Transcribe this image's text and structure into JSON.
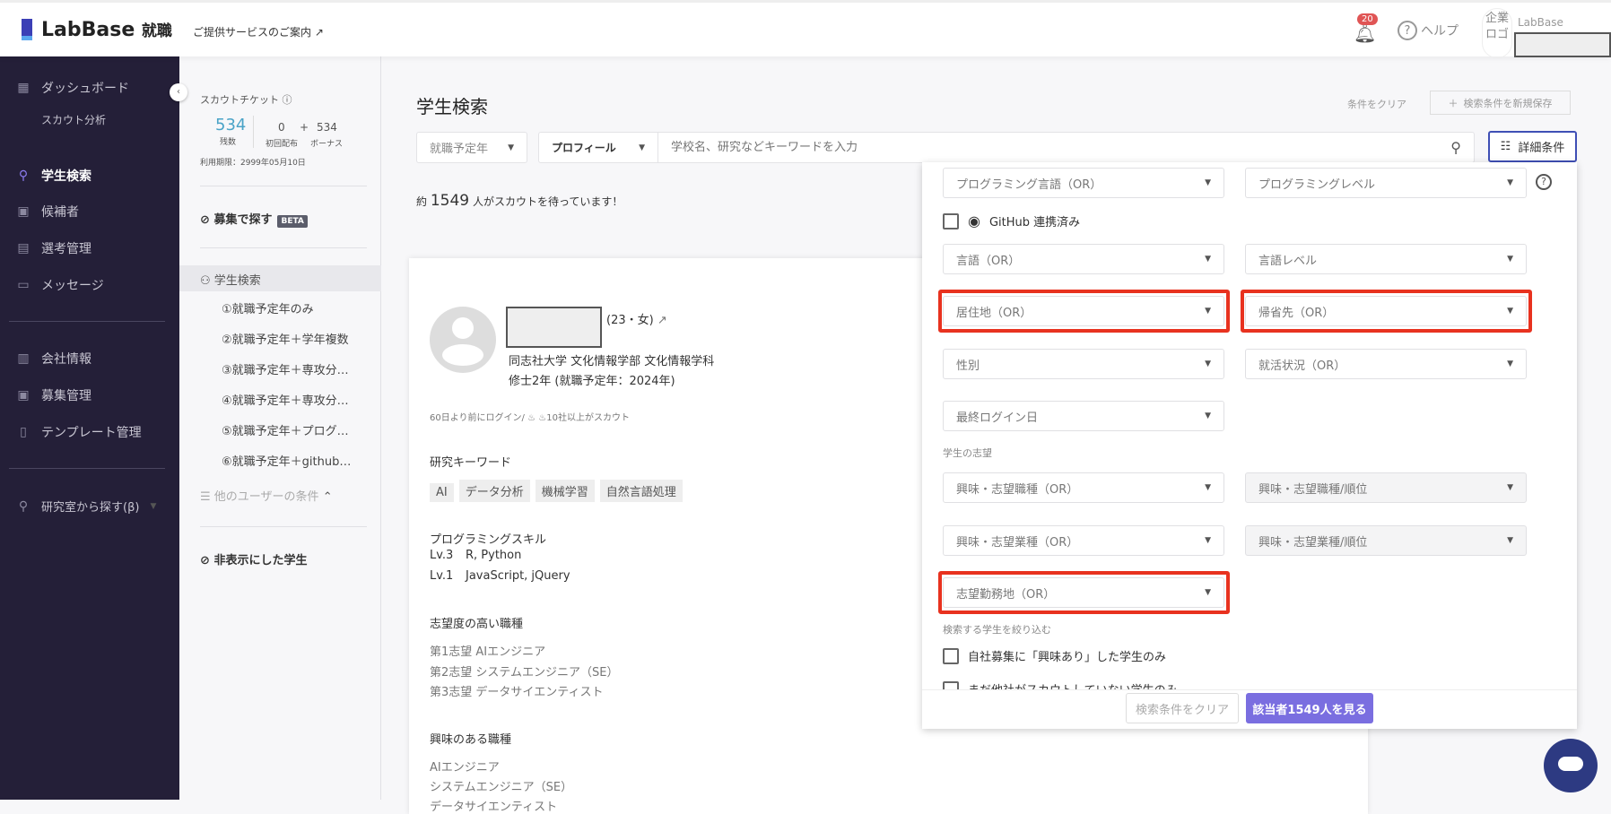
{
  "header": {
    "brand": "LabBase",
    "brand_suffix": "就職",
    "services_link": "ご提供サービスのご案内",
    "notification_count": "20",
    "help": "ヘルプ",
    "company_logo_alt": "企業ロゴ",
    "account_label": "LabBase"
  },
  "nav": {
    "items": [
      {
        "label": "ダッシュボード",
        "icon": "dashboard-icon"
      },
      {
        "label": "スカウト分析"
      },
      {
        "label": "学生検索",
        "icon": "search-icon",
        "active": true
      },
      {
        "label": "候補者",
        "icon": "candidate-icon"
      },
      {
        "label": "選考管理",
        "icon": "selection-icon"
      },
      {
        "label": "メッセージ",
        "icon": "message-icon"
      },
      {
        "label": "会社情報",
        "icon": "building-icon"
      },
      {
        "label": "募集管理",
        "icon": "recruit-icon"
      },
      {
        "label": "テンプレート管理",
        "icon": "document-icon"
      },
      {
        "label": "研究室から探す(β)",
        "icon": "search-icon"
      }
    ]
  },
  "sub": {
    "ticket_title": "スカウトチケット",
    "remaining": "534",
    "remaining_label": "残数",
    "initial": "0",
    "plus": "+",
    "bonus": "534",
    "initial_label": "初回配布",
    "bonus_label": "ボーナス",
    "expiry": "利用期限：2999年05月10日",
    "recruit_search": "募集で探す",
    "beta": "BETA",
    "student_search": "学生検索",
    "saved": [
      "①就職予定年のみ",
      "②就職予定年＋学年複数",
      "③就職予定年＋専攻分…",
      "④就職予定年＋専攻分…",
      "⑤就職予定年＋プログ…",
      "⑥就職予定年＋github…"
    ],
    "other_users": "他のユーザーの条件",
    "hidden": "非表示にした学生"
  },
  "main": {
    "title": "学生検索",
    "clear": "条件をクリア",
    "save": "検索条件を新規保存",
    "year_select": "就職予定年",
    "profile_select": "プロフィール",
    "search_placeholder": "学校名、研究などキーワードを入力",
    "detail": "詳細条件",
    "count_prefix": "約",
    "count": "1549",
    "count_suffix": "人がスカウトを待っています！"
  },
  "card": {
    "age_gender": "(23・女)",
    "school": "同志社大学 文化情報学部 文化情報学科",
    "grade": "修士2年 (就職予定年：2024年)",
    "login": "60日より前にログイン/",
    "scouted": "10社以上がスカウト",
    "kw_title": "研究キーワード",
    "keywords": [
      "AI",
      "データ分析",
      "機械学習",
      "自然言語処理"
    ],
    "skill_title": "プログラミングスキル",
    "skills": [
      {
        "level": "Lv.3",
        "langs": "R, Python"
      },
      {
        "level": "Lv.1",
        "langs": "JavaScript, jQuery"
      }
    ],
    "wish_title": "志望度の高い職種",
    "wishes": [
      "第1志望 AIエンジニア",
      "第2志望 システムエンジニア（SE）",
      "第3志望 データサイエンティスト"
    ],
    "interest_title": "興味のある職種",
    "interests": [
      "AIエンジニア",
      "システムエンジニア（SE）",
      "データサイエンティスト"
    ]
  },
  "panel": {
    "prog_lang": "プログラミング言語（OR）",
    "prog_level": "プログラミングレベル",
    "github": "GitHub 連携済み",
    "lang": "言語（OR）",
    "lang_level": "言語レベル",
    "residence": "居住地（OR）",
    "hometown": "帰省先（OR）",
    "gender": "性別",
    "job_status": "就活状況（OR）",
    "last_login": "最終ログイン日",
    "wish_section": "学生の志望",
    "job_type": "興味・志望職種（OR）",
    "job_type_rank": "興味・志望職種/順位",
    "industry": "興味・志望業種（OR）",
    "industry_rank": "興味・志望業種/順位",
    "work_location": "志望勤務地（OR）",
    "narrow_section": "検索する学生を絞り込む",
    "interested_only": "自社募集に「興味あり」した学生のみ",
    "not_scouted": "まだ他社がスカウトしていない学生のみ",
    "clear": "検索条件をクリア",
    "show": "該当者1549人を見る",
    "highlight_color": "#e8321f",
    "primary_color": "#7a6ee0"
  }
}
